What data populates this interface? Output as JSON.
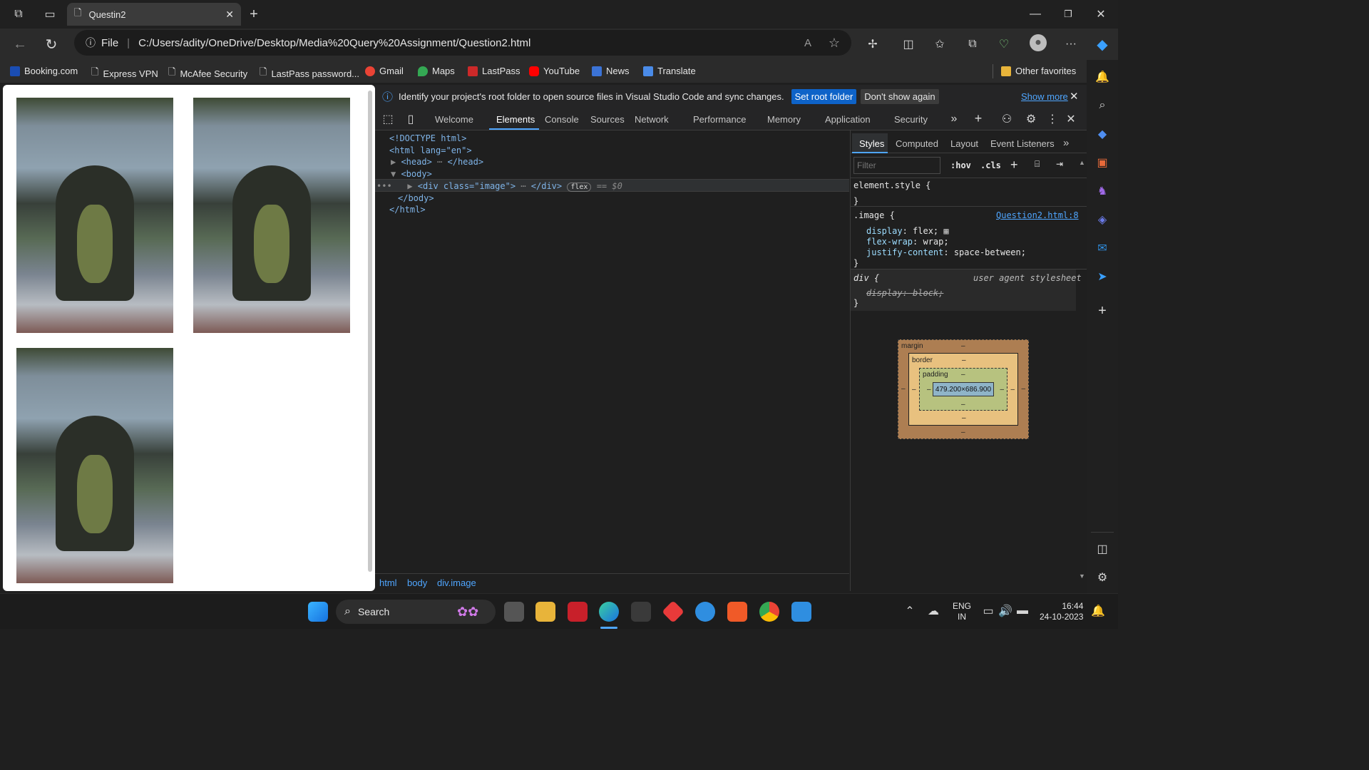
{
  "browser": {
    "tab_title": "Questin2",
    "address_scheme": "File",
    "address_url": "C:/Users/adity/OneDrive/Desktop/Media%20Query%20Assignment/Question2.html",
    "favorites": [
      {
        "label": "Booking.com",
        "color": "#1a4db3"
      },
      {
        "label": "Express VPN",
        "color": "#cccccc"
      },
      {
        "label": "McAfee Security",
        "color": "#cccccc"
      },
      {
        "label": "LastPass password...",
        "color": "#cccccc"
      },
      {
        "label": "Gmail",
        "color": "#ea4335"
      },
      {
        "label": "Maps",
        "color": "#34a853"
      },
      {
        "label": "LastPass",
        "color": "#cc2929"
      },
      {
        "label": "YouTube",
        "color": "#ff0000"
      },
      {
        "label": "News",
        "color": "#3b73d6"
      },
      {
        "label": "Translate",
        "color": "#4a8be8"
      }
    ],
    "other_favorites": "Other favorites"
  },
  "devtools": {
    "info_message": "Identify your project's root folder to open source files in Visual Studio Code and sync changes.",
    "set_root_label": "Set root folder",
    "dont_show_label": "Don't show again",
    "show_more_label": "Show more",
    "tabs": [
      "Welcome",
      "Elements",
      "Console",
      "Sources",
      "Network",
      "Performance",
      "Memory",
      "Application",
      "Security"
    ],
    "active_tab": "Elements",
    "dom_lines": {
      "doctype": "<!DOCTYPE html>",
      "html_open": "<html lang=\"en\">",
      "head": "<head>",
      "head_close": "</head>",
      "body_open": "<body>",
      "div_tag": "<div class=\"image\">",
      "div_close": "</div>",
      "flex_badge": "flex",
      "dollar": "== $0",
      "body_close": "</body>",
      "html_close": "</html>"
    },
    "breadcrumbs": [
      "html",
      "body",
      "div.image"
    ],
    "styles_tabs": [
      "Styles",
      "Computed",
      "Layout",
      "Event Listeners"
    ],
    "filter_placeholder": "Filter",
    "hov_label": ":hov",
    "cls_label": ".cls",
    "element_style": "element.style {",
    "close_brace": "}",
    "image_selector": ".image {",
    "image_source": "Question2.html:8",
    "props": [
      {
        "name": "display",
        "value": "flex;"
      },
      {
        "name": "flex-wrap",
        "value": "wrap;"
      },
      {
        "name": "justify-content",
        "value": "space-between;"
      }
    ],
    "div_selector": "div {",
    "ua_label": "user agent stylesheet",
    "ua_prop": "display: block;",
    "box_model": {
      "margin_label": "margin",
      "border_label": "border",
      "padding_label": "padding",
      "content_size": "479.200×686.900",
      "dash": "–"
    }
  },
  "taskbar": {
    "search_label": "Search",
    "lang_top": "ENG",
    "lang_bottom": "IN",
    "time": "16:44",
    "date": "24-10-2023"
  }
}
